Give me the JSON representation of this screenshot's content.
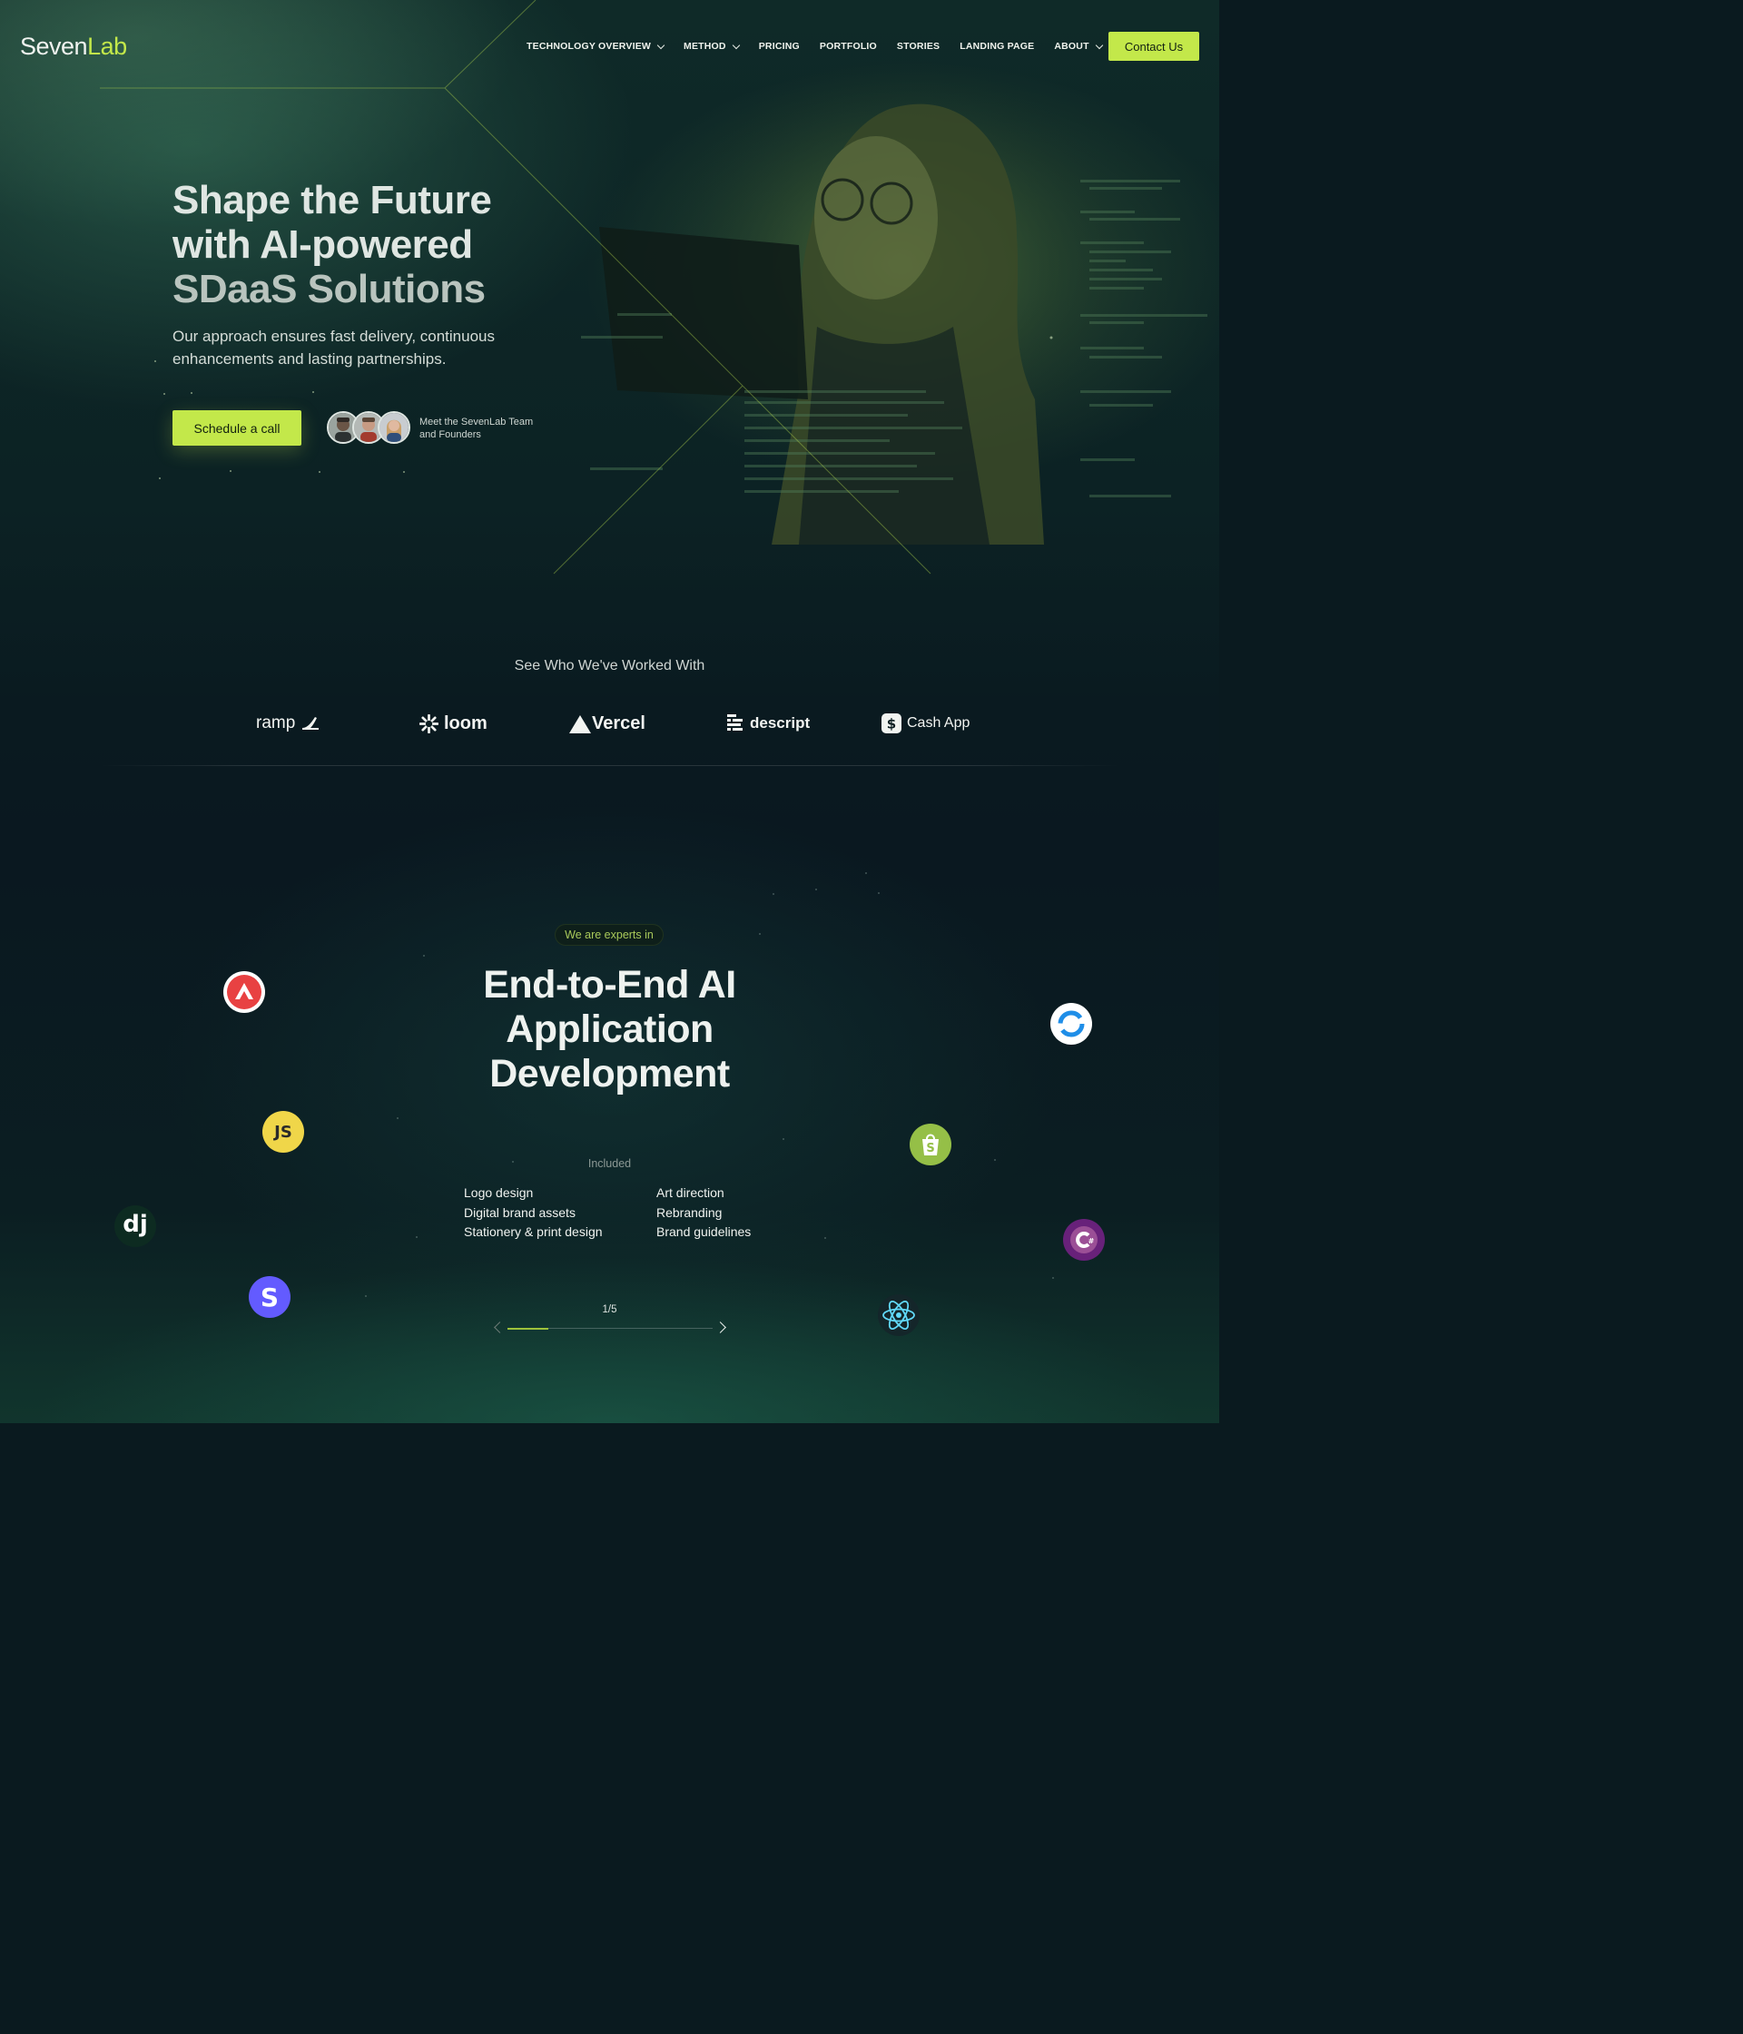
{
  "header": {
    "logo": {
      "part1": "Seven",
      "part2": "Lab"
    },
    "nav": [
      {
        "label": "TECHNOLOGY OVERVIEW",
        "dropdown": true
      },
      {
        "label": "METHOD",
        "dropdown": true
      },
      {
        "label": "PRICING",
        "dropdown": false
      },
      {
        "label": "PORTFOLIO",
        "dropdown": false
      },
      {
        "label": "STORIES",
        "dropdown": false
      },
      {
        "label": "LANDING PAGE",
        "dropdown": false
      },
      {
        "label": "ABOUT",
        "dropdown": true
      }
    ],
    "contact_label": "Contact Us"
  },
  "hero": {
    "title_lines": [
      "Shape the Future",
      "with AI-powered",
      "SDaaS Solutions"
    ],
    "subtitle": "Our approach ensures fast delivery, continuous enhancements and lasting partnerships.",
    "cta_label": "Schedule a call",
    "team_text": "Meet the SevenLab Team and Founders"
  },
  "clients": {
    "title": "See Who We've Worked With",
    "logos": [
      {
        "name": "ramp",
        "icon": "ramp-icon"
      },
      {
        "name": "loom",
        "icon": "loom-asterisk-icon"
      },
      {
        "name": "Vercel",
        "icon": "vercel-triangle-icon"
      },
      {
        "name": "descript",
        "icon": "descript-icon"
      },
      {
        "name": "Cash App",
        "icon": "cash-app-icon"
      }
    ]
  },
  "expertise": {
    "pill": "We are experts in",
    "title_lines": [
      "End-to-End AI",
      "Application",
      "Development"
    ],
    "included_label": "Included",
    "included_left": [
      "Logo design",
      "Digital brand assets",
      "Stationery & print design"
    ],
    "included_right": [
      "Art direction",
      "Rebranding",
      "Brand guidelines"
    ],
    "pager": "1/5",
    "progress": 0.2,
    "tech_icons": [
      "avalanche-icon",
      "javascript-icon",
      "django-icon",
      "stripe-icon",
      "sync-icon",
      "shopify-icon",
      "csharp-icon",
      "react-icon"
    ]
  },
  "colors": {
    "accent": "#c3e84a",
    "background": "#0a1a1f"
  }
}
